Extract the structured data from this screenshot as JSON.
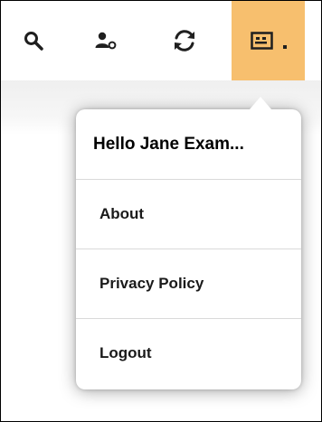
{
  "toolbar": {
    "icons": [
      "search-icon",
      "user-icon",
      "refresh-icon",
      "account-card-icon"
    ],
    "account_button_color": "#f7bf6e"
  },
  "menu": {
    "greeting": "Hello Jane Exam...",
    "items": [
      {
        "label": "About"
      },
      {
        "label": "Privacy Policy"
      },
      {
        "label": "Logout"
      }
    ]
  }
}
